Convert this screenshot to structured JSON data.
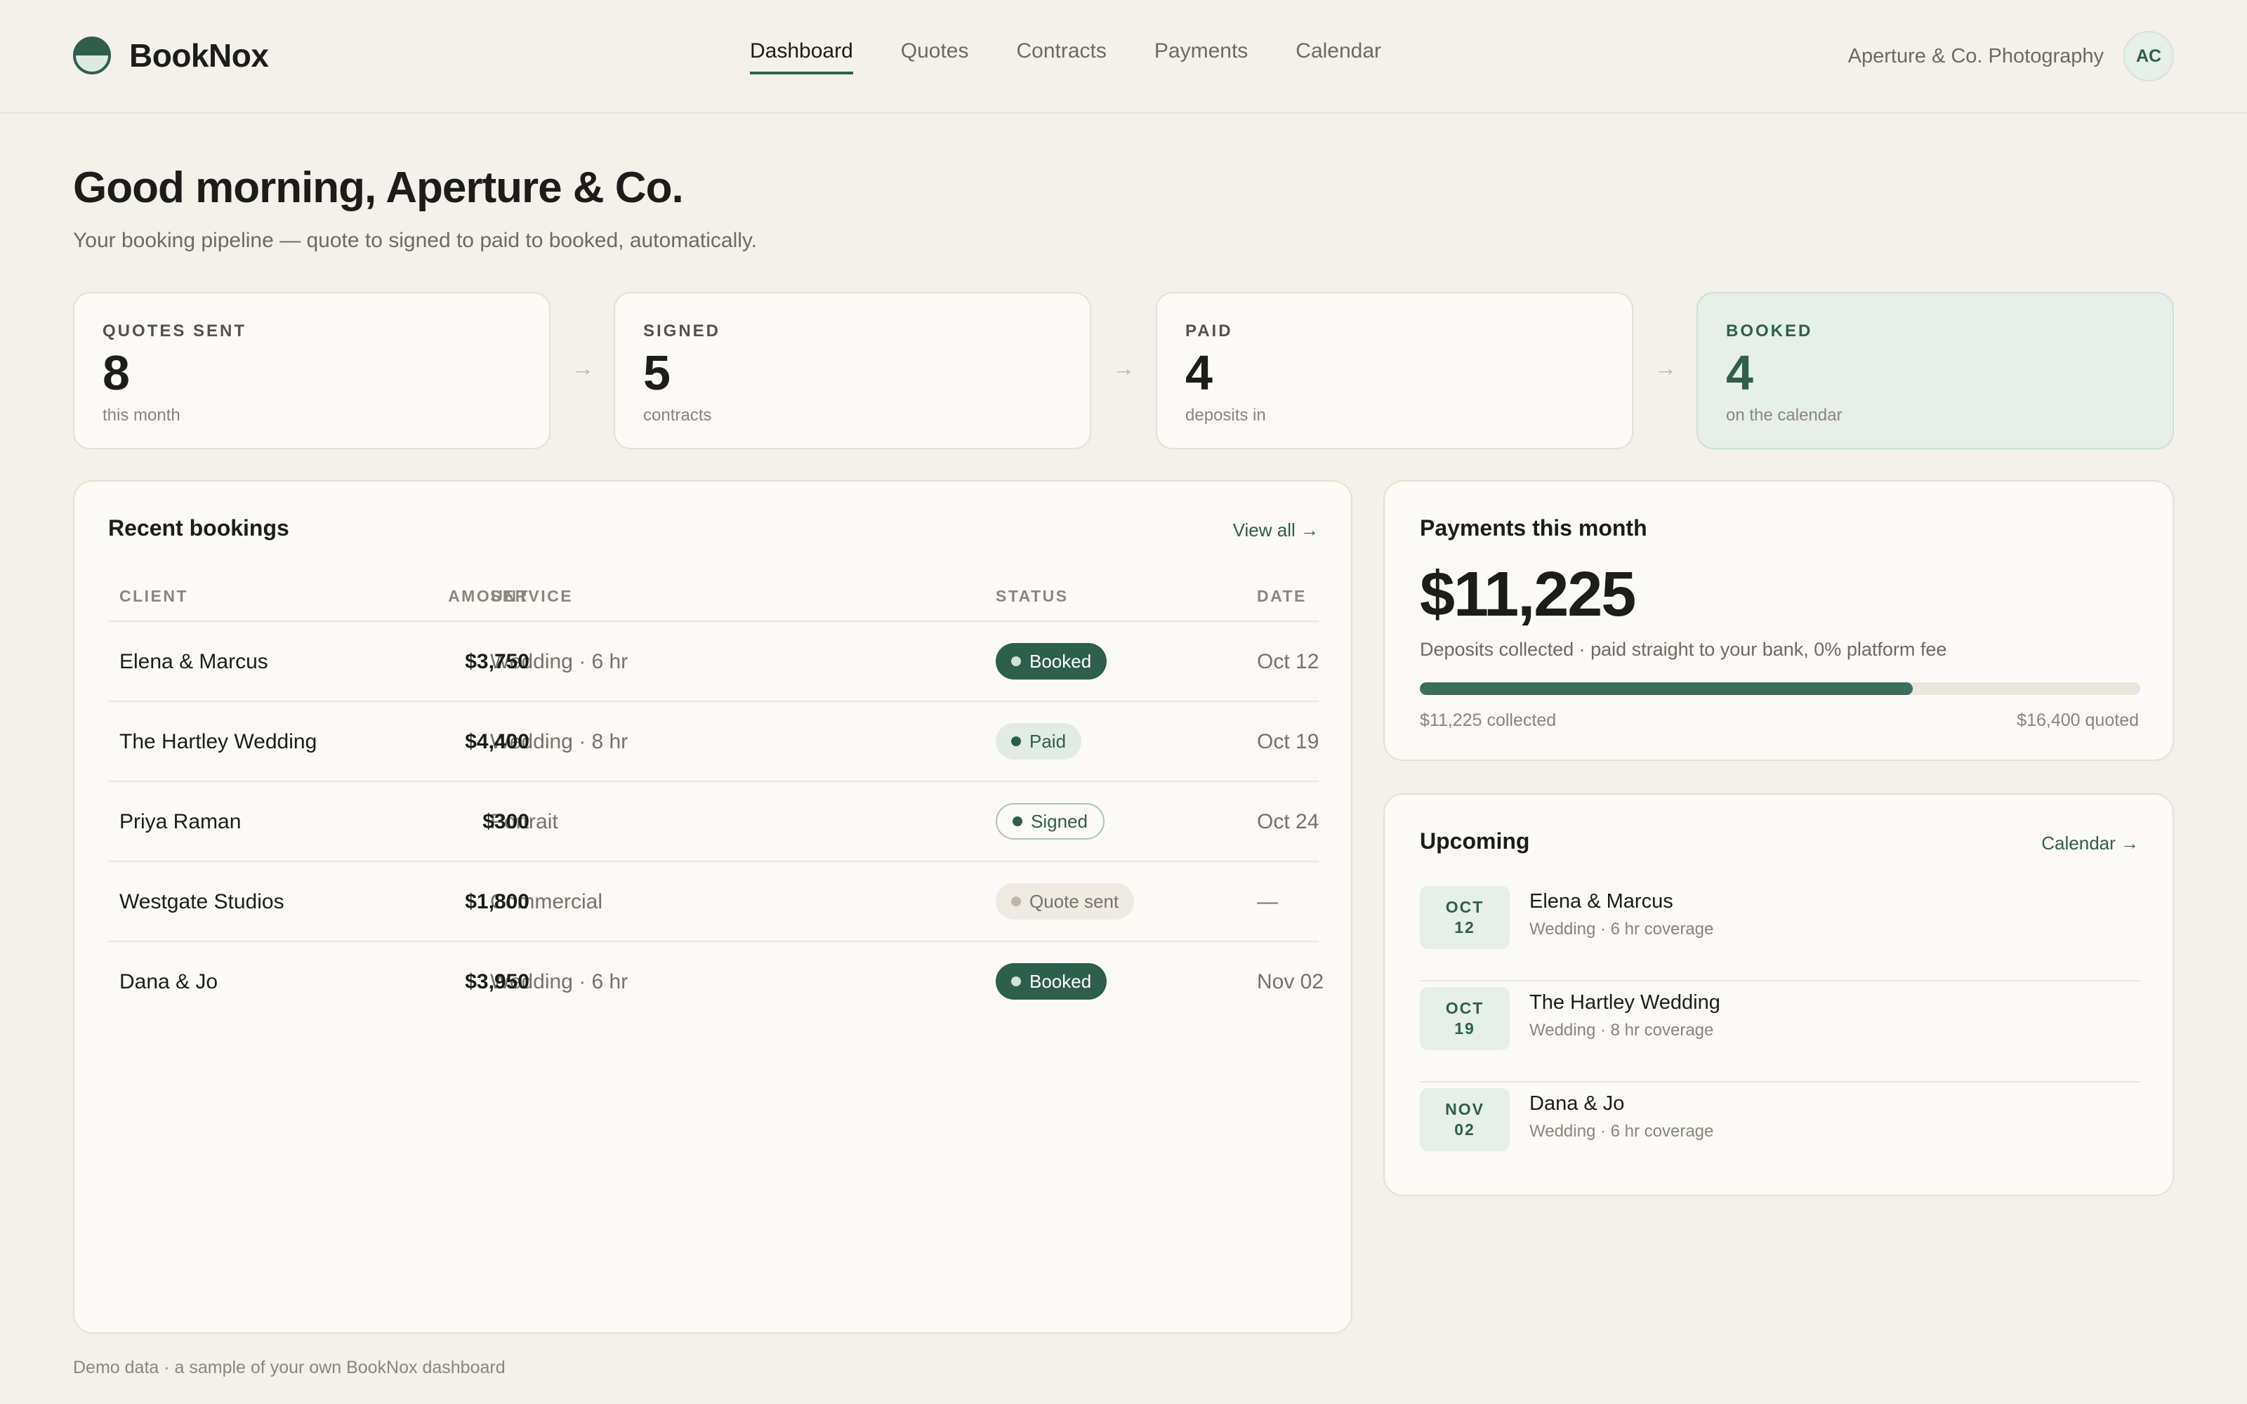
{
  "app": {
    "name": "BookNox",
    "account_name": "Aperture & Co. Photography",
    "avatar_initials": "AC",
    "accent_color": "#2e5e4c"
  },
  "nav": {
    "items": [
      {
        "label": "Dashboard",
        "active": true
      },
      {
        "label": "Quotes",
        "active": false
      },
      {
        "label": "Contracts",
        "active": false
      },
      {
        "label": "Payments",
        "active": false
      },
      {
        "label": "Calendar",
        "active": false
      }
    ]
  },
  "greeting": {
    "title": "Good morning, Aperture & Co.",
    "subtitle": "Your booking pipeline — quote to signed to paid to booked, automatically."
  },
  "pipeline": {
    "arrow_glyph": "→",
    "stages": [
      {
        "label": "QUOTES SENT",
        "value": "8",
        "sub": "this month"
      },
      {
        "label": "SIGNED",
        "value": "5",
        "sub": "contracts"
      },
      {
        "label": "PAID",
        "value": "4",
        "sub": "deposits in"
      },
      {
        "label": "BOOKED",
        "value": "4",
        "sub": "on the calendar"
      }
    ]
  },
  "bookings": {
    "title": "Recent bookings",
    "view_all": "View all →",
    "columns": [
      "CLIENT",
      "SERVICE",
      "AMOUNT",
      "STATUS",
      "DATE"
    ],
    "rows": [
      {
        "client": "Elena & Marcus",
        "service": "Wedding · 6 hr",
        "amount": "$3,750",
        "status": "Booked",
        "date": "Oct 12"
      },
      {
        "client": "The Hartley Wedding",
        "service": "Wedding · 8 hr",
        "amount": "$4,400",
        "status": "Paid",
        "date": "Oct 19"
      },
      {
        "client": "Priya Raman",
        "service": "Portrait",
        "amount": "$300",
        "status": "Signed",
        "date": "Oct 24"
      },
      {
        "client": "Westgate Studios",
        "service": "Commercial",
        "amount": "$1,800",
        "status": "Quote sent",
        "date": "—"
      },
      {
        "client": "Dana & Jo",
        "service": "Wedding · 6 hr",
        "amount": "$3,950",
        "status": "Booked",
        "date": "Nov 02"
      }
    ]
  },
  "payments": {
    "title": "Payments this month",
    "amount": "$11,225",
    "description": "Deposits collected · paid straight to your bank, 0% platform fee",
    "collected_label": "$11,225 collected",
    "quoted_label": "$16,400 quoted",
    "progress_fraction": 0.684
  },
  "upcoming": {
    "title": "Upcoming",
    "link": "Calendar →",
    "items": [
      {
        "month": "OCT",
        "day": "12",
        "name": "Elena & Marcus",
        "detail": "Wedding · 6 hr coverage"
      },
      {
        "month": "OCT",
        "day": "19",
        "name": "The Hartley Wedding",
        "detail": "Wedding · 8 hr coverage"
      },
      {
        "month": "NOV",
        "day": "02",
        "name": "Dana & Jo",
        "detail": "Wedding · 6 hr coverage"
      }
    ]
  },
  "footer": {
    "note": "Demo data · a sample of your own BookNox dashboard"
  }
}
